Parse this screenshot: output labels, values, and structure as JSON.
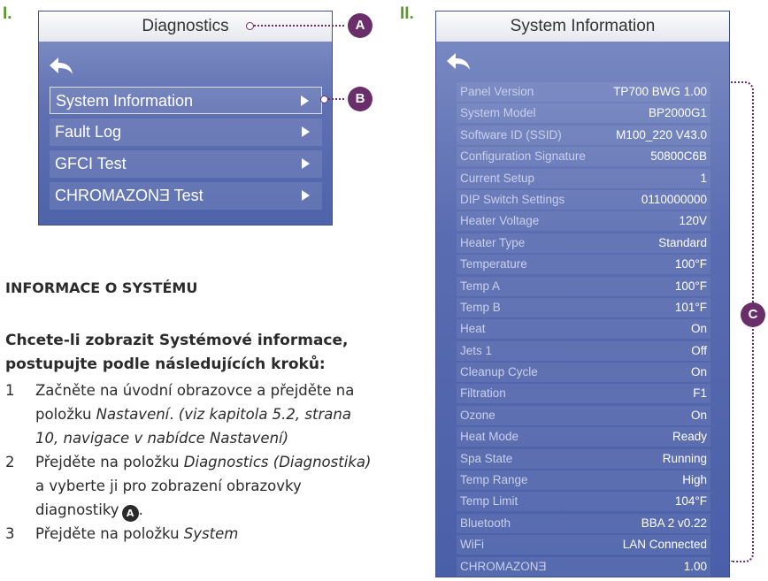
{
  "section_labels": {
    "one": "I.",
    "two": "II."
  },
  "diagnostics_screen": {
    "title": "Diagnostics",
    "items": [
      {
        "label": "System Information",
        "selected": true
      },
      {
        "label": "Fault Log",
        "selected": false
      },
      {
        "label": "GFCI Test",
        "selected": false
      },
      {
        "label": "CHROMAZONƎ Test",
        "selected": false
      }
    ]
  },
  "callouts": {
    "a": "A",
    "b": "B",
    "c": "C"
  },
  "text": {
    "heading": "INFORMACE O SYSTÉMU",
    "intro": "Chcete-li zobrazit Systémové informace, postupujte podle následujících kroků:",
    "steps": [
      {
        "num": "1",
        "a": "Začněte na úvodní obrazovce a přejděte na položku ",
        "b": "Nastavení",
        "c": ". ",
        "d": "(viz kapitola 5.2, strana 10, navigace v nabídce Nastavení)"
      },
      {
        "num": "2",
        "a": "Přejděte na položku ",
        "b": "Diagnostics (Diagnostika)",
        "c": " a vyberte ji pro zobrazení obrazovky diagnostiky",
        "d": "."
      },
      {
        "num": "3",
        "a": "Přejděte na položku ",
        "b": "System"
      }
    ]
  },
  "system_info_screen": {
    "title": "System Information",
    "rows": [
      {
        "label": "Panel Version",
        "value": "TP700 BWG 1.00"
      },
      {
        "label": "System Model",
        "value": "BP2000G1"
      },
      {
        "label": "Software ID (SSID)",
        "value": "M100_220 V43.0"
      },
      {
        "label": "Configuration Signature",
        "value": "50800C6B"
      },
      {
        "label": "Current Setup",
        "value": "1"
      },
      {
        "label": "DIP Switch Settings",
        "value": "0110000000"
      },
      {
        "label": "Heater Voltage",
        "value": "120V"
      },
      {
        "label": "Heater Type",
        "value": "Standard"
      },
      {
        "label": "Temperature",
        "value": "100°F"
      },
      {
        "label": "Temp A",
        "value": "100°F"
      },
      {
        "label": "Temp B",
        "value": "101°F"
      },
      {
        "label": "Heat",
        "value": "On"
      },
      {
        "label": "Jets 1",
        "value": "Off"
      },
      {
        "label": "Cleanup Cycle",
        "value": "On"
      },
      {
        "label": "Filtration",
        "value": "F1"
      },
      {
        "label": "Ozone",
        "value": "On"
      },
      {
        "label": "Heat Mode",
        "value": "Ready"
      },
      {
        "label": "Spa State",
        "value": "Running"
      },
      {
        "label": "Temp Range",
        "value": "High"
      },
      {
        "label": "Temp Limit",
        "value": "104°F"
      },
      {
        "label": "Bluetooth",
        "value": "BBA 2 v0.22"
      },
      {
        "label": "WiFi",
        "value": "LAN Connected"
      },
      {
        "label": "CHROMAZONƎ",
        "value": "1.00"
      }
    ]
  },
  "colors": {
    "accent_green": "#5a9a2a",
    "callout_purple": "#6a2e6a",
    "screen_blue": "#5a6cb1"
  }
}
